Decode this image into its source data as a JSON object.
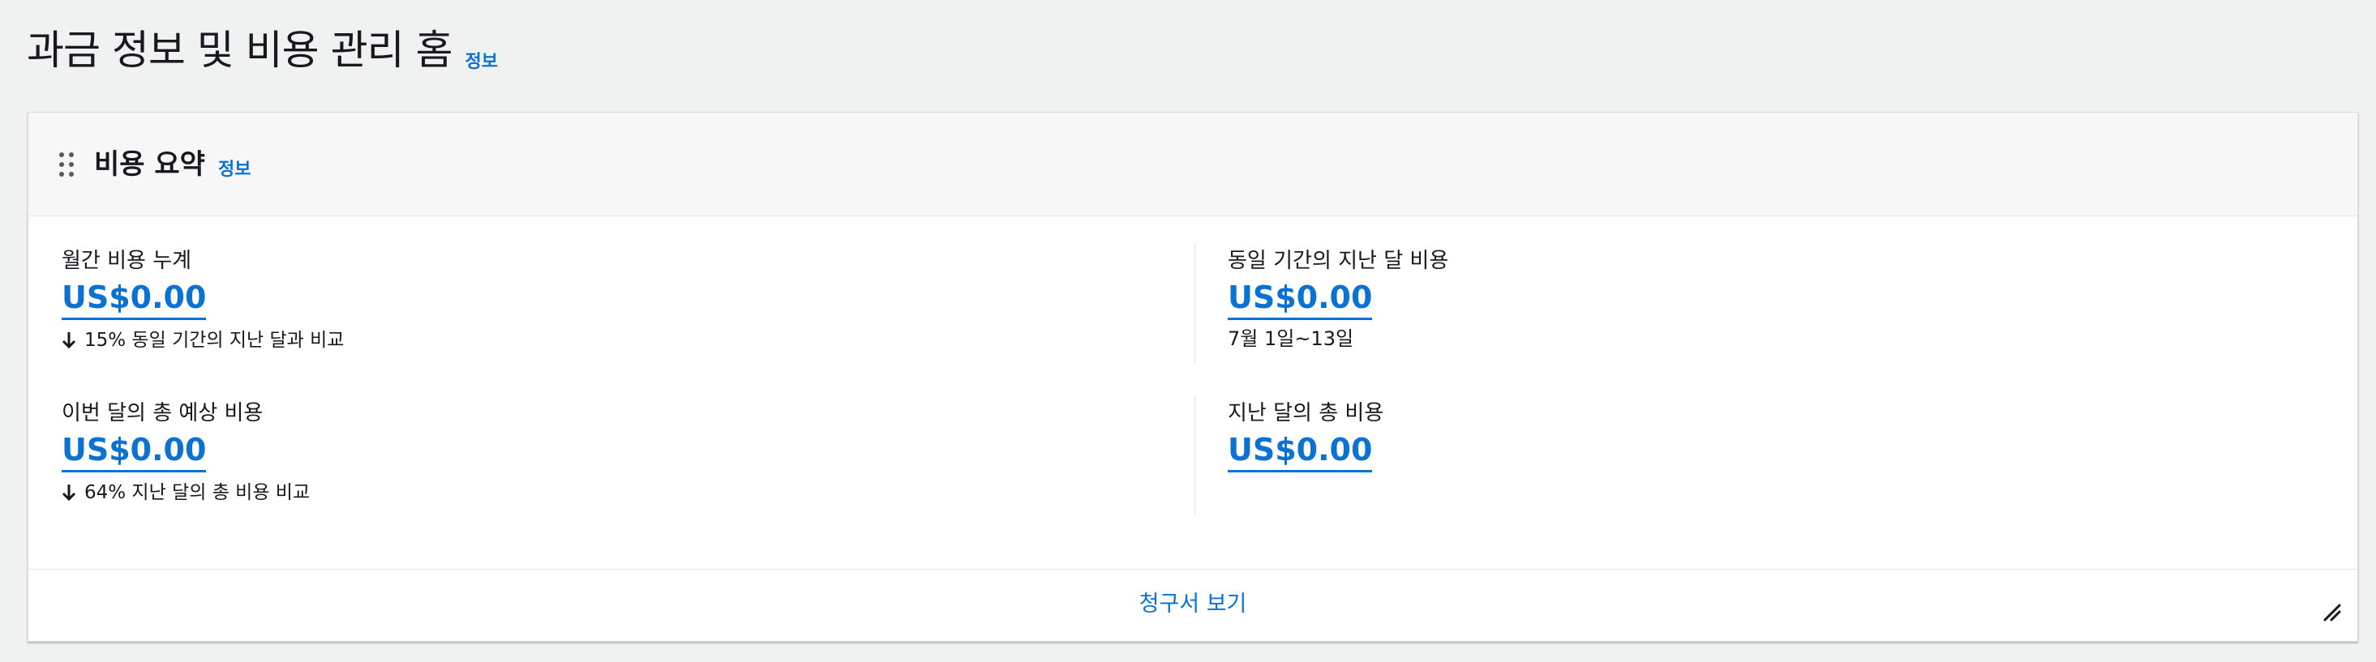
{
  "page": {
    "title": "과금 정보 및 비용 관리 홈",
    "info_label": "정보"
  },
  "card": {
    "title": "비용 요약",
    "info_label": "정보",
    "drag_handle_icon": "drag-handle-icon",
    "resize_icon": "resize-icon",
    "footer_link": "청구서 보기"
  },
  "metrics": {
    "month_to_date": {
      "label": "월간 비용 누계",
      "value": "US$0.00",
      "note": "15% 동일 기간의 지난 달과 비교",
      "note_icon": "arrow-down-icon"
    },
    "last_month_same_period": {
      "label": "동일 기간의 지난 달 비용",
      "value": "US$0.00",
      "date_range": "7월 1일~13일"
    },
    "forecast": {
      "label": "이번 달의 총 예상 비용",
      "value": "US$0.00",
      "note": "64% 지난 달의 총 비용 비교",
      "note_icon": "arrow-down-icon"
    },
    "last_month_total": {
      "label": "지난 달의 총 비용",
      "value": "US$0.00"
    }
  },
  "colors": {
    "link": "#0972d3",
    "background": "#f0f1f1",
    "card_header": "#f7f7f7",
    "text": "#16191f"
  }
}
